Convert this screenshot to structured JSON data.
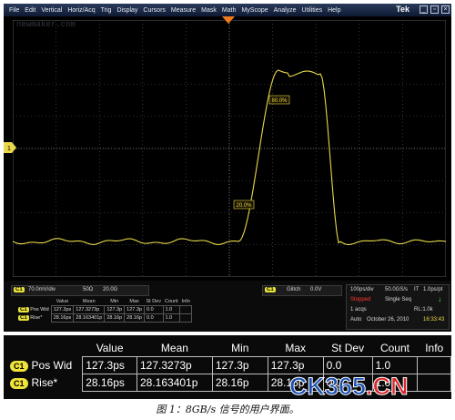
{
  "menu": {
    "items": [
      "File",
      "Edit",
      "Vertical",
      "Horiz/Acq",
      "Trig",
      "Display",
      "Cursors",
      "Measure",
      "Mask",
      "Math",
      "MyScope",
      "Analyze",
      "Utilities",
      "Help"
    ],
    "brand": "Tek"
  },
  "screen": {
    "watermark": "newmaker.com",
    "ref_label_low": "20.0%",
    "ref_label_high": "80.0%",
    "trigger_marker": "T",
    "channel_marker": "1"
  },
  "status": {
    "channel": "C1",
    "scale": "70.0mV/div",
    "impedance": "50Ω",
    "bandwidth": "20.0G",
    "glitch_label": "Glitch",
    "glitch_value": "0.0V",
    "timebase": "100ps/div",
    "sample_rate": "50.0GS/s",
    "pt": "IT",
    "pts": "1.0ps/pt",
    "run_state": "Stopped",
    "mode": "Single Seq",
    "acqs": "1 acqs",
    "record": "RL:1.0k",
    "trigger_mode": "Auto",
    "date": "October 26, 2010",
    "time": "16:33:43",
    "small_table": {
      "headers": [
        "Value",
        "Mean",
        "Min",
        "Max",
        "St Dev",
        "Count",
        "Info"
      ],
      "rows": [
        {
          "ch": "C1",
          "name": "Pos Wid",
          "cells": [
            "127.3ps",
            "127.3273p",
            "127.3p",
            "127.3p",
            "0.0",
            "1.0",
            ""
          ]
        },
        {
          "ch": "C1",
          "name": "Rise*",
          "cells": [
            "28.16ps",
            "28.163401p",
            "28.16p",
            "28.16p",
            "0.0",
            "1.0",
            ""
          ]
        }
      ]
    }
  },
  "zoom_table": {
    "headers": [
      "Value",
      "Mean",
      "Min",
      "Max",
      "St Dev",
      "Count",
      "Info"
    ],
    "rows": [
      {
        "ch": "C1",
        "name": "Pos Wid",
        "cells": [
          "127.3ps",
          "127.3273p",
          "127.3p",
          "127.3p",
          "0.0",
          "1.0",
          ""
        ]
      },
      {
        "ch": "C1",
        "name": "Rise*",
        "cells": [
          "28.16ps",
          "28.163401p",
          "28.16p",
          "28.16p",
          "0.0",
          "1.0",
          ""
        ]
      }
    ]
  },
  "logo": {
    "part1": "CK365",
    "part2": ".CN"
  },
  "caption": "图 1：8GB/s 信号的用户界面。",
  "colors": {
    "trace": "#e8d84a",
    "screen": "#000000",
    "badge": "#f0e43a",
    "logo_blue": "#1a4fb0",
    "logo_red": "#d8262c"
  }
}
